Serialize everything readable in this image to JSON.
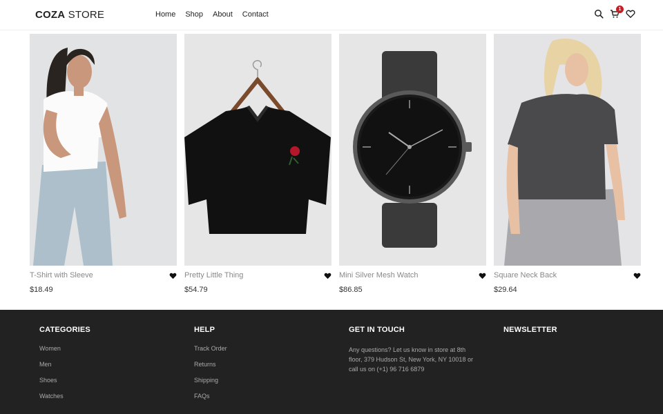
{
  "header": {
    "logo_bold": "COZA",
    "logo_light": " STORE",
    "nav": [
      "Home",
      "Shop",
      "About",
      "Contact"
    ],
    "icons": [
      "search-icon",
      "cart-icon",
      "heart-icon"
    ],
    "cart_count": "1"
  },
  "products": [
    {
      "name": "T-Shirt with Sleeve",
      "price": "$18.49",
      "image": "woman-white-tshirt-jeans"
    },
    {
      "name": "Pretty Little Thing",
      "price": "$54.79",
      "image": "black-crop-top-on-hanger"
    },
    {
      "name": "Mini Silver Mesh Watch",
      "price": "$86.85",
      "image": "black-mesh-watch"
    },
    {
      "name": "Square Neck Back",
      "price": "$29.64",
      "image": "woman-grey-tshirt-joggers"
    }
  ],
  "footer": {
    "categories": {
      "title": "CATEGORIES",
      "links": [
        "Women",
        "Men",
        "Shoes",
        "Watches"
      ]
    },
    "help": {
      "title": "HELP",
      "links": [
        "Track Order",
        "Returns",
        "Shipping",
        "FAQs"
      ]
    },
    "contact": {
      "title": "GET IN TOUCH",
      "text": "Any questions? Let us know in store at 8th floor, 379 Hudson St, New York, NY 10018 or call us on (+1) 96 716 6879"
    },
    "newsletter": {
      "title": "NEWSLETTER"
    }
  },
  "colors": {
    "badge": "#c81d25",
    "footer_bg": "#222222",
    "image_bg": "#e6e6e6"
  }
}
